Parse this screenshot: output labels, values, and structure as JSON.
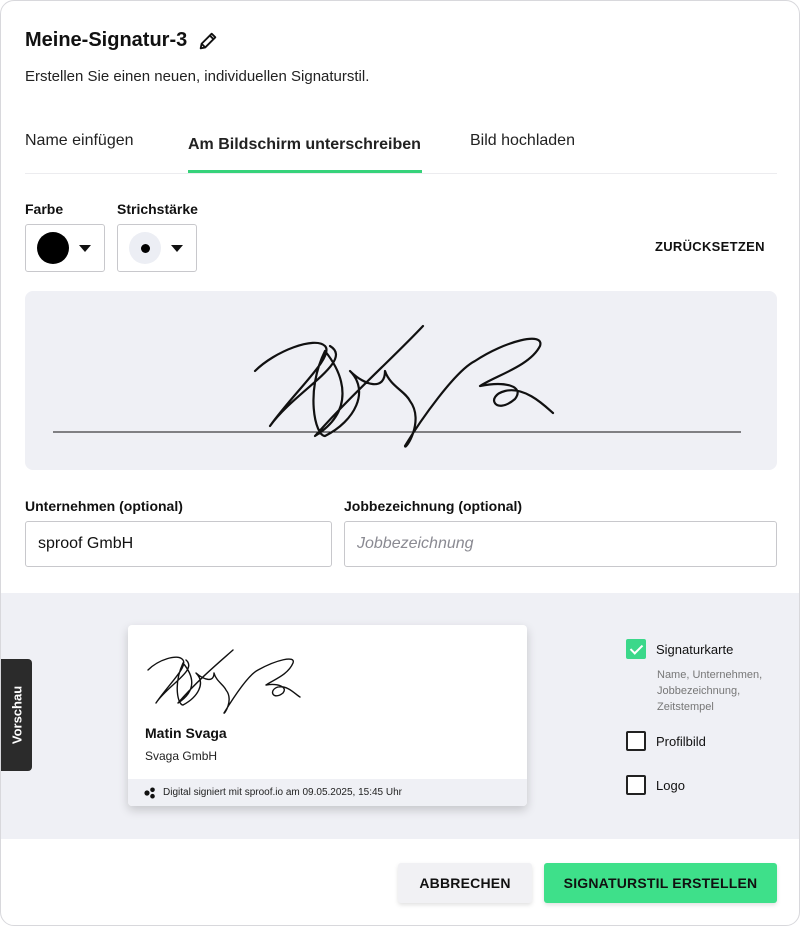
{
  "dialog": {
    "title": "Meine-Signatur-3",
    "subtitle": "Erstellen Sie einen neuen, individuellen Signaturstil."
  },
  "tabs": [
    {
      "label": "Name einfügen"
    },
    {
      "label": "Am Bildschirm unterschreiben",
      "active": true
    },
    {
      "label": "Bild hochladen"
    }
  ],
  "toolbar": {
    "color_label": "Farbe",
    "stroke_label": "Strichstärke",
    "reset_label": "ZURÜCKSETZEN",
    "selected_color": "#000000"
  },
  "form": {
    "company_label": "Unternehmen (optional)",
    "company_value": "sproof GmbH",
    "job_label": "Jobbezeichnung (optional)",
    "job_placeholder": "Jobbezeichnung"
  },
  "preview": {
    "tab_label": "Vorschau",
    "card": {
      "name": "Matin Svaga",
      "company": "Svaga GmbH",
      "footer": "Digital signiert mit sproof.io am 09.05.2025, 15:45 Uhr"
    },
    "options": [
      {
        "label": "Signaturkarte",
        "checked": true,
        "description": "Name, Unternehmen, Jobbezeichnung, Zeitstempel"
      },
      {
        "label": "Profilbild",
        "checked": false
      },
      {
        "label": "Logo",
        "checked": false
      }
    ]
  },
  "actions": {
    "cancel_label": "ABBRECHEN",
    "create_label": "SIGNATURSTIL ERSTELLEN"
  },
  "colors": {
    "accent": "#36d27a",
    "primary_button": "#3ee08a",
    "panel_bg": "#eff0f5"
  },
  "icons": {
    "edit": "pencil-icon",
    "dropdown": "caret-down-icon",
    "check": "check-icon",
    "brand": "sproof-logo-icon"
  }
}
